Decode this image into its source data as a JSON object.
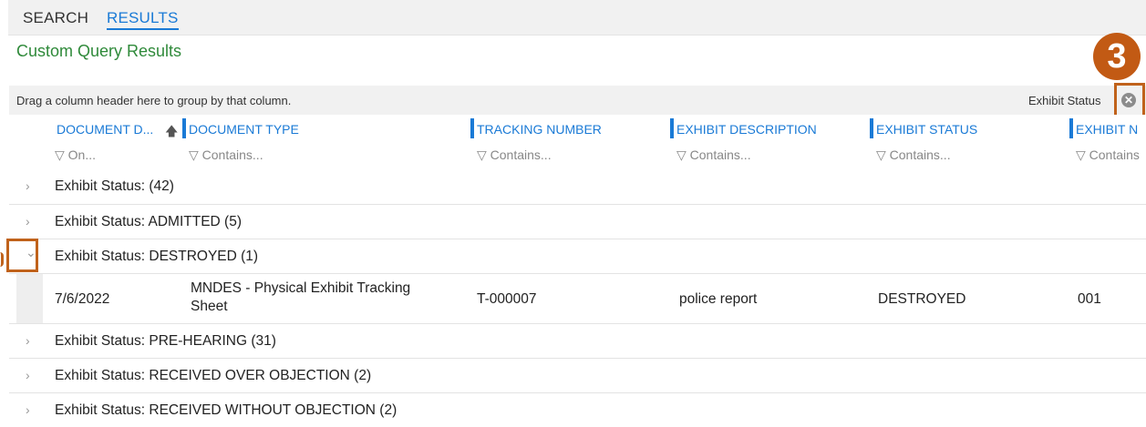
{
  "tabs": {
    "search": "SEARCH",
    "results": "RESULTS"
  },
  "page_title": "Custom Query Results",
  "group_panel": {
    "hint": "Drag a column header here to group by that column.",
    "chip_label": "Exhibit Status",
    "remove_glyph": "✕"
  },
  "callout": {
    "number": "3",
    "color": "#c25a14"
  },
  "columns": {
    "document_date": {
      "label": "DOCUMENT D...",
      "filter": "▽ On..."
    },
    "document_type": {
      "label": "DOCUMENT TYPE",
      "filter": "▽ Contains..."
    },
    "tracking_number": {
      "label": "TRACKING NUMBER",
      "filter": "▽ Contains..."
    },
    "exhibit_description": {
      "label": "EXHIBIT DESCRIPTION",
      "filter": "▽ Contains..."
    },
    "exhibit_status": {
      "label": "EXHIBIT STATUS",
      "filter": "▽ Contains..."
    },
    "exhibit_n": {
      "label": "EXHIBIT N",
      "filter": "▽ Contains"
    }
  },
  "sort_icon": "🡅",
  "groups": [
    {
      "label": "Exhibit Status: (42)",
      "chevron": "›"
    },
    {
      "label": "Exhibit Status: ADMITTED (5)",
      "chevron": "›"
    },
    {
      "label": "Exhibit Status: DESTROYED (1)",
      "chevron": "⌄"
    },
    {
      "label": "Exhibit Status: PRE-HEARING (31)",
      "chevron": "›"
    },
    {
      "label": "Exhibit Status: RECEIVED OVER OBJECTION (2)",
      "chevron": "›"
    },
    {
      "label": "Exhibit Status: RECEIVED WITHOUT OBJECTION (2)",
      "chevron": "›"
    }
  ],
  "data_row": {
    "document_date": "7/6/2022",
    "document_type_line1": "MNDES - Physical Exhibit Tracking",
    "document_type_line2": "Sheet",
    "tracking_number": "T-000007",
    "exhibit_description": "police report",
    "exhibit_status": "DESTROYED",
    "exhibit_number": "001"
  }
}
